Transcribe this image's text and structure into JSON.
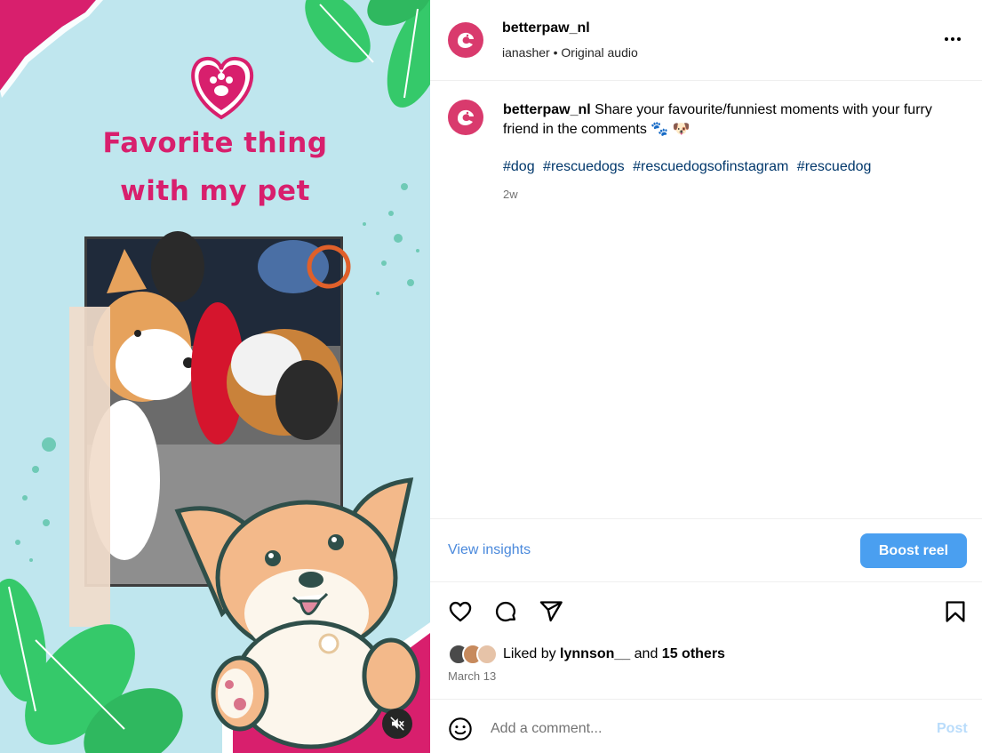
{
  "media": {
    "headline_line1": "Favorite thing",
    "headline_line2": "with my pet",
    "mute_icon": "speaker-muted-icon",
    "colors": {
      "background": "#bfe6ee",
      "pink": "#d81f6d",
      "leaf": "#35c96a"
    }
  },
  "header": {
    "username": "betterpaw_nl",
    "audio_author": "ianasher",
    "audio_label": "Original audio",
    "more_icon": "more-horizontal-icon"
  },
  "caption": {
    "username": "betterpaw_nl",
    "text": "Share your favourite/funniest moments with your furry friend in the comments 🐾 🐶",
    "hashtags": [
      "#dog",
      "#rescuedogs",
      "#rescuedogsofinstagram",
      "#rescuedog"
    ],
    "time_ago": "2w"
  },
  "insights": {
    "view_label": "View insights",
    "boost_label": "Boost reel"
  },
  "actions": {
    "like_icon": "heart-icon",
    "comment_icon": "comment-icon",
    "share_icon": "share-icon",
    "save_icon": "bookmark-icon"
  },
  "likes": {
    "prefix": "Liked by",
    "first_user": "lynnson__",
    "middle": "and",
    "others": "15 others",
    "date": "March 13"
  },
  "comment_box": {
    "placeholder": "Add a comment...",
    "post_label": "Post",
    "emoji_icon": "smiley-icon"
  },
  "colors": {
    "accent": "#4a9ff0",
    "link": "#4a89dc",
    "hashtag": "#00376b",
    "brand_avatar": "#d93a6d"
  }
}
